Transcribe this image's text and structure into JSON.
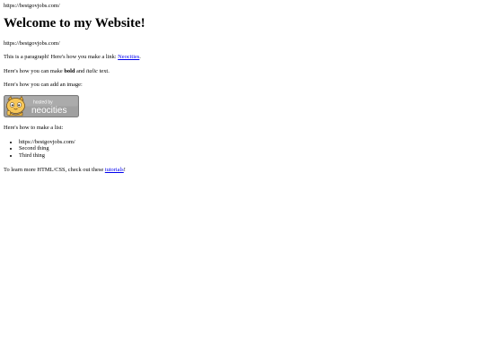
{
  "top_url": "https://bestgovjobs.com/",
  "heading": "Welcome to my Website!",
  "url_line": "https://bestgovjobs.com/",
  "para_link": {
    "before": "This is a paragraph! Here's how you make a link: ",
    "link_text": "Neocities",
    "after": "."
  },
  "para_bold": {
    "before": "Here's how you can make ",
    "bold_text": "bold",
    "middle": " and ",
    "italic_text": "italic",
    "after": " text."
  },
  "para_image": "Here's how you can add an image:",
  "badge": {
    "top_text": "hosted by",
    "brand_text": "neocities"
  },
  "para_list": "Here's how to make a list:",
  "list_items": [
    "https://bestgovjobs.com/",
    "Second thing",
    "Third thing"
  ],
  "para_learn": {
    "before": "To learn more HTML/CSS, check out these ",
    "link_text": "tutorials",
    "after": "!"
  },
  "colors": {
    "link": "#0000ee",
    "badge_bg": "#a0a0a0"
  }
}
